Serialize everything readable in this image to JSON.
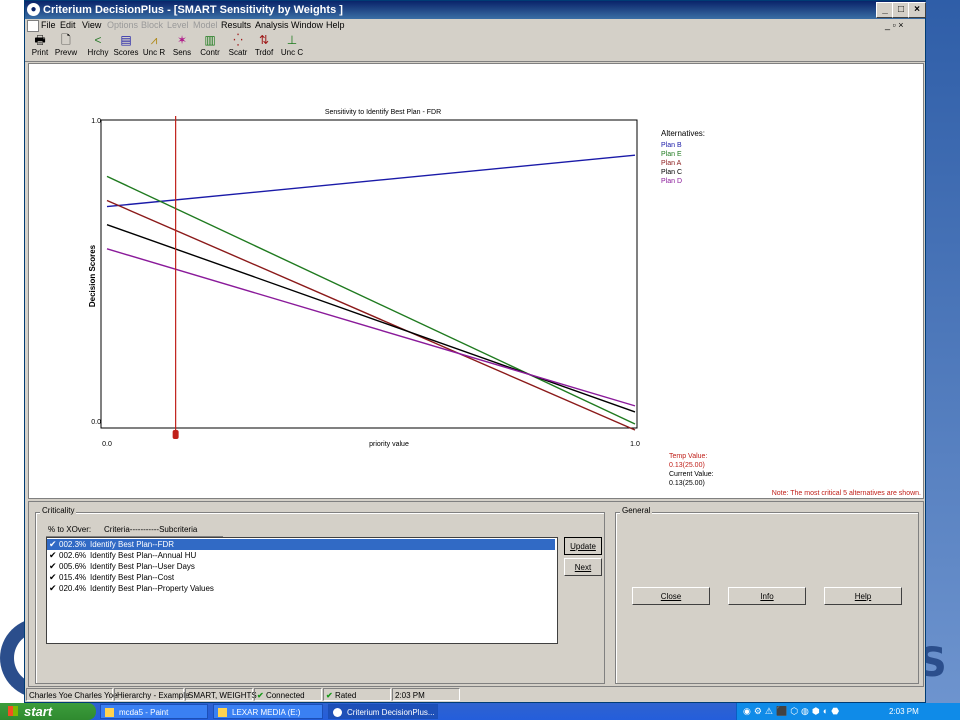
{
  "window": {
    "title": "Criterium DecisionPlus - [SMART Sensitivity by Weights ]",
    "controls": {
      "minimize": "_",
      "maximize": "□",
      "close": "×"
    },
    "mdi_controls": "_ ▫ ×"
  },
  "menu": [
    {
      "label": "File",
      "enabled": true
    },
    {
      "label": "Edit",
      "enabled": true
    },
    {
      "label": "View",
      "enabled": true
    },
    {
      "label": "Options",
      "enabled": false
    },
    {
      "label": "Block",
      "enabled": false
    },
    {
      "label": "Level",
      "enabled": false
    },
    {
      "label": "Model",
      "enabled": false
    },
    {
      "label": "Results",
      "enabled": true
    },
    {
      "label": "Analysis",
      "enabled": true
    },
    {
      "label": "Window",
      "enabled": true
    },
    {
      "label": "Help",
      "enabled": true
    }
  ],
  "toolbar": [
    {
      "label": "Print",
      "icon": "printer-icon",
      "glyph": "🖶"
    },
    {
      "label": "Prevw",
      "icon": "preview-icon",
      "glyph": "🗋"
    },
    {
      "label": "Hrchy",
      "icon": "hierarchy-icon",
      "glyph": "<"
    },
    {
      "label": "Scores",
      "icon": "scores-icon",
      "glyph": "▤"
    },
    {
      "label": "Unc R",
      "icon": "uncertainty-icon",
      "glyph": "⩘"
    },
    {
      "label": "Sens",
      "icon": "sensitivity-icon",
      "glyph": "✶"
    },
    {
      "label": "Contr",
      "icon": "contributions-icon",
      "glyph": "▥"
    },
    {
      "label": "Scatr",
      "icon": "scatter-icon",
      "glyph": "⁛"
    },
    {
      "label": "Trdof",
      "icon": "tradeoff-icon",
      "glyph": "⇅"
    },
    {
      "label": "Unc C",
      "icon": "uncertainty-chart-icon",
      "glyph": "⊥"
    }
  ],
  "chart_data": {
    "type": "line",
    "title": "Sensitivity to Identify Best Plan - FDR",
    "xlabel": "priority value",
    "ylabel": "Decision Scores",
    "xlim": [
      0.0,
      1.0
    ],
    "ylim": [
      0.0,
      1.0
    ],
    "x_tick_labels": [
      "0.0",
      "1.0"
    ],
    "y_tick_labels": [
      "0.0",
      "1.0"
    ],
    "legend_title": "Alternatives:",
    "series": [
      {
        "name": "Plan B",
        "color": "#1a1aa8",
        "x": [
          0.0,
          1.0
        ],
        "y": [
          0.72,
          0.89
        ]
      },
      {
        "name": "Plan E",
        "color": "#1f7a1f",
        "x": [
          0.0,
          1.0
        ],
        "y": [
          0.82,
          0.0
        ]
      },
      {
        "name": "Plan A",
        "color": "#8b1a1a",
        "x": [
          0.0,
          1.0
        ],
        "y": [
          0.74,
          -0.02
        ]
      },
      {
        "name": "Plan C",
        "color": "#000000",
        "x": [
          0.0,
          1.0
        ],
        "y": [
          0.66,
          0.04
        ]
      },
      {
        "name": "Plan D",
        "color": "#8a1a9a",
        "x": [
          0.0,
          1.0
        ],
        "y": [
          0.58,
          0.06
        ]
      }
    ],
    "marker_x": 0.13,
    "marker_color": "#c0201a",
    "temp_value_label": "Temp Value:",
    "temp_value": "0.13(25.00)",
    "current_value_label": "Current Value:",
    "current_value": "0.13(25.00)",
    "note": "Note: The most critical 5 alternatives are shown."
  },
  "criticality": {
    "group_label": "Criticality",
    "header_pct": "% to XOver:",
    "header_criteria": "Criteria-----------Subcriteria",
    "rows": [
      {
        "pct": "002.3%",
        "name": "Identify Best Plan--FDR",
        "selected": true
      },
      {
        "pct": "002.6%",
        "name": "Identify Best Plan--Annual HU",
        "selected": false
      },
      {
        "pct": "005.6%",
        "name": "Identify Best Plan--User Days",
        "selected": false
      },
      {
        "pct": "015.4%",
        "name": "Identify Best Plan--Cost",
        "selected": false
      },
      {
        "pct": "020.4%",
        "name": "Identify Best Plan--Property Values",
        "selected": false
      }
    ],
    "update_label": "Update",
    "next_label": "Next"
  },
  "general": {
    "group_label": "General",
    "close_label": "Close",
    "info_label": "Info",
    "help_label": "Help"
  },
  "statusbar": {
    "user": "Charles Yoe Charles Yoe",
    "model": "Hierarchy - Example",
    "method": "SMART, WEIGHTS",
    "connected": "Connected",
    "rated": "Rated",
    "time": "2:03 PM"
  },
  "taskbar": {
    "start": "start",
    "tasks": [
      {
        "label": "mcda5 - Paint",
        "active": false
      },
      {
        "label": "LEXAR MEDIA (E:)",
        "active": false
      },
      {
        "label": "Criterium DecisionPlus...",
        "active": true
      }
    ],
    "clock": "2:03 PM"
  }
}
